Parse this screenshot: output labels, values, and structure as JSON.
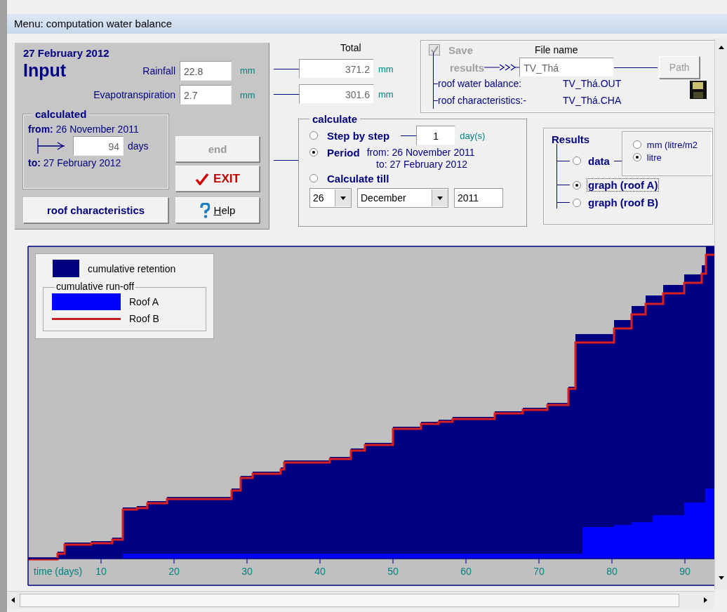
{
  "window": {
    "title": "Menu: computation water balance"
  },
  "input_panel": {
    "date": "27 February 2012",
    "heading": "Input",
    "fields": [
      {
        "label": "Rainfall",
        "value": "22.8",
        "unit": "mm"
      },
      {
        "label": "Evapotranspiration",
        "value": "2.7",
        "unit": "mm"
      }
    ],
    "calculated": {
      "title": "calculated",
      "from_label": "from:",
      "from": "26 November 2011",
      "days": "94",
      "days_unit": "days",
      "to_label": "to:",
      "to": "27 February 2012"
    },
    "buttons": [
      {
        "label": "end",
        "kind": "end",
        "disabled": true
      },
      {
        "label": "EXIT",
        "kind": "exit",
        "disabled": false
      },
      {
        "label": "roof characteristics",
        "kind": "plain",
        "disabled": false
      },
      {
        "label": "Help",
        "kind": "help",
        "disabled": false
      }
    ]
  },
  "totals": {
    "heading": "Total",
    "fields": [
      {
        "value": "371.2",
        "unit": "mm"
      },
      {
        "value": "301.6",
        "unit": "mm"
      }
    ]
  },
  "save": {
    "label_1": "Save",
    "label_2": "results",
    "checked": true,
    "disabled": true,
    "file_name_label": "File name",
    "file_name": "TV_Thá",
    "path_button": "Path",
    "outputs": [
      {
        "label": "roof water balance:",
        "file": "TV_Thá.OUT"
      },
      {
        "label": "roof characteristics:-",
        "file": "TV_Thá.CHA"
      }
    ]
  },
  "calculate": {
    "title": "calculate",
    "modes": [
      {
        "label": "Step by step",
        "selected": false,
        "kind": "step",
        "value": "1",
        "unit": "day(s)"
      },
      {
        "label": "Period",
        "selected": true,
        "kind": "period",
        "from_label": "from:",
        "from": "26 November 2011",
        "to_label": "to:",
        "to": "27 February 2012"
      },
      {
        "label": "Calculate till",
        "selected": false,
        "kind": "till"
      }
    ],
    "till_date": {
      "day": "26",
      "month": "December",
      "year": "2011"
    }
  },
  "results": {
    "title": "Results",
    "options": [
      {
        "label": "data",
        "selected": false,
        "kind": "data"
      },
      {
        "label": "graph (roof A)",
        "selected": true,
        "kind": "graph"
      },
      {
        "label": "graph (roof B)",
        "selected": false,
        "kind": "graph"
      }
    ],
    "units": [
      {
        "label": "mm (litre/m2",
        "selected": false
      },
      {
        "label": "litre",
        "selected": true
      }
    ]
  },
  "chart": {
    "legend": {
      "retention": "cumulative retention",
      "runoff_title": "cumulative run-off",
      "series": [
        {
          "label": "Roof A",
          "kind": "area"
        },
        {
          "label": "Roof B",
          "kind": "line"
        }
      ]
    },
    "x_axis": {
      "label": "time (days)",
      "ticks": [
        "10",
        "20",
        "30",
        "40",
        "50",
        "60",
        "70",
        "80",
        "90"
      ]
    }
  }
}
